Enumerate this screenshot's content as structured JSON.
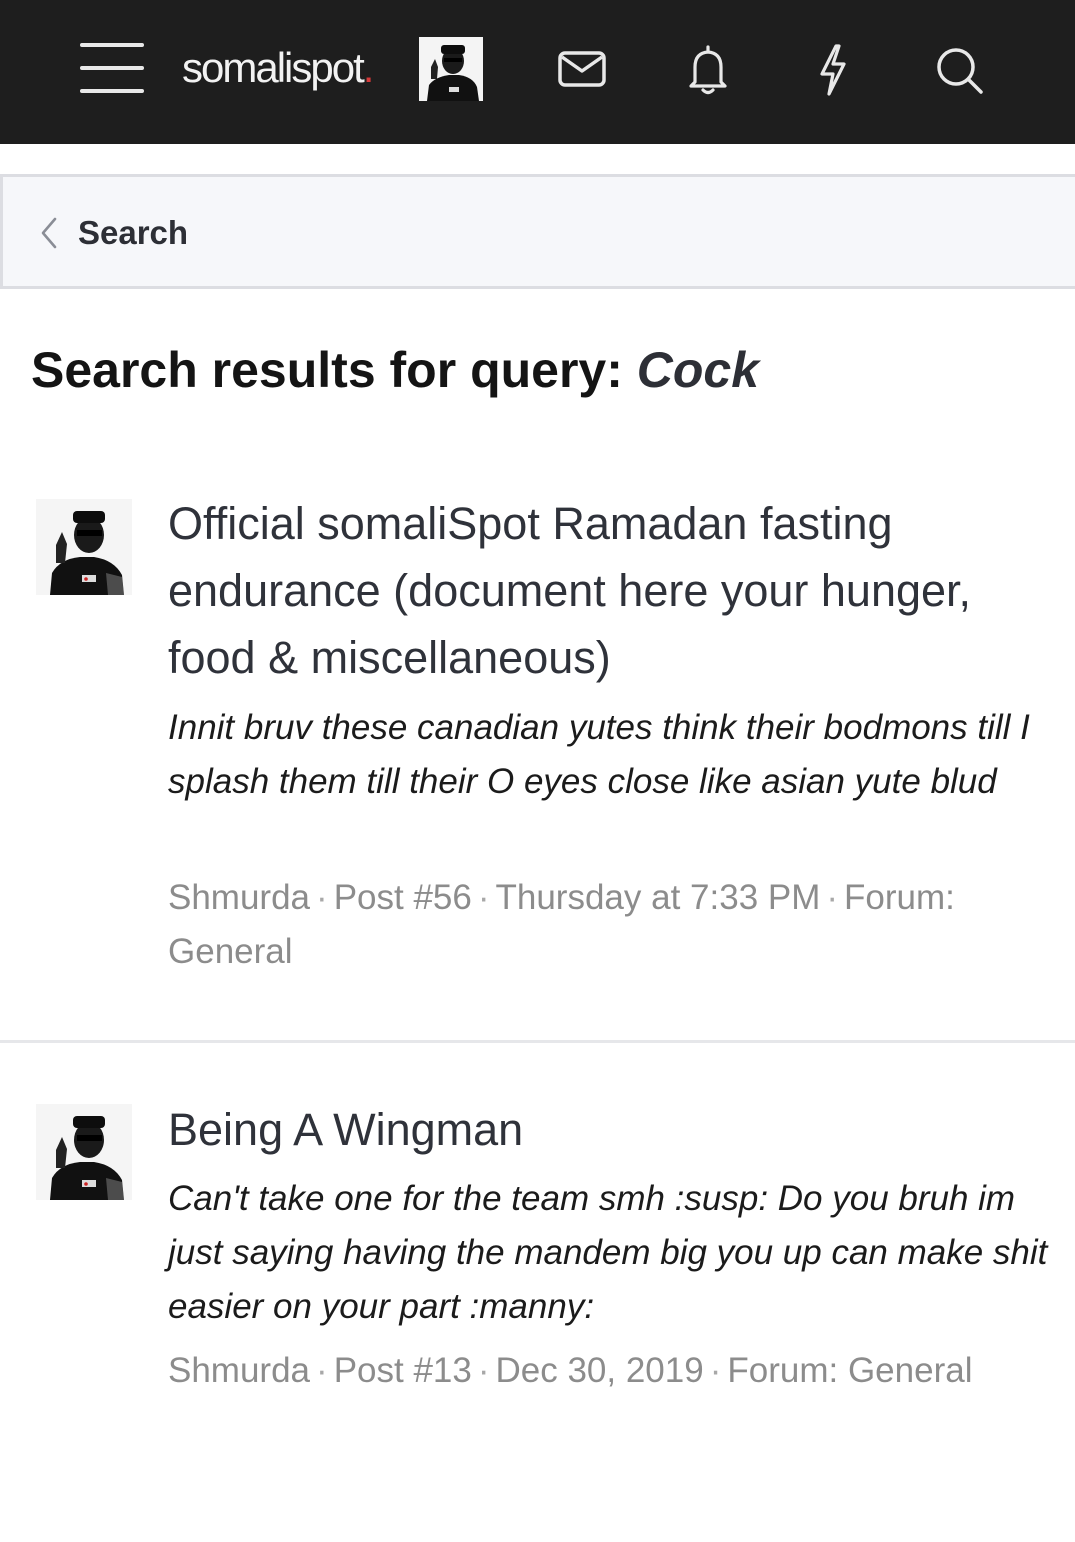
{
  "header": {
    "logo_text": "somalispot",
    "logo_dot": ".",
    "menu_icon": "hamburger-menu-icon",
    "avatar_icon": "user-avatar",
    "icons": [
      "envelope-icon",
      "bell-icon",
      "lightning-icon",
      "search-icon"
    ],
    "colors": {
      "background": "#1e1e1e",
      "logo_accent": "#d63a3a"
    }
  },
  "breadcrumb": {
    "icon": "chevron-left-icon",
    "label": "Search"
  },
  "page": {
    "title_prefix": "Search results for query: ",
    "query": "Cock"
  },
  "results": [
    {
      "title": "Official somaliSpot Ramadan fasting endurance (document here your hunger, food & miscellaneous)",
      "snippet": "Innit bruv these canadian yutes think their bodmons till I splash them till their O eyes close like asian yute blud",
      "author": "Shmurda",
      "post": "Post #56",
      "date": "Thursday at 7:33 PM",
      "forum_prefix": "Forum: ",
      "forum": "General",
      "sep": "·"
    },
    {
      "title": "Being A Wingman",
      "snippet": "Can't take one for the team smh :susp: Do you bruh im just saying having the mandem big you up can make shit easier on your part :manny:",
      "author": "Shmurda",
      "post": "Post #13",
      "date": "Dec 30, 2019",
      "forum_prefix": "Forum: ",
      "forum": "General",
      "sep": "·"
    }
  ]
}
